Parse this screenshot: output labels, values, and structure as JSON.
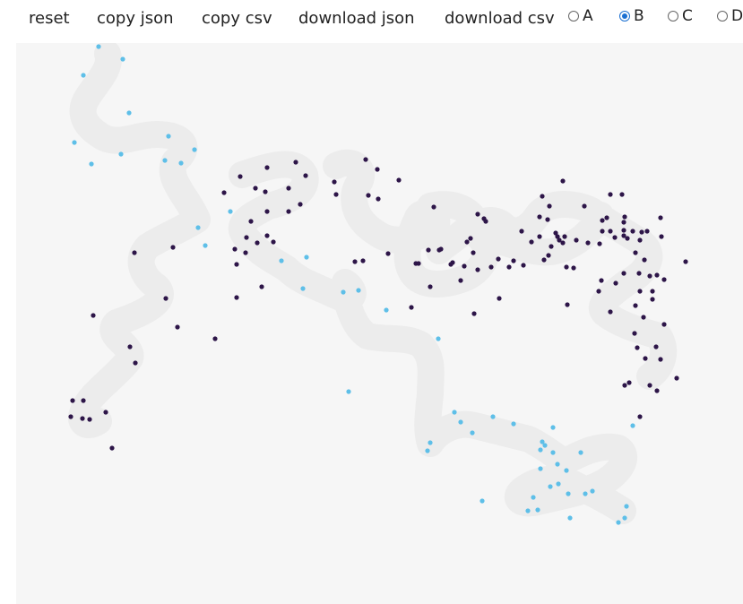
{
  "toolbar": {
    "reset": "reset",
    "copy_json": "copy json",
    "copy_csv": "copy csv",
    "download_json": "download json",
    "download_csv": "download csv"
  },
  "radios": [
    {
      "label": "A",
      "checked": false
    },
    {
      "label": "B",
      "checked": true
    },
    {
      "label": "C",
      "checked": false
    },
    {
      "label": "D",
      "checked": false
    }
  ],
  "colors": {
    "path": "#ececec",
    "series_dark": "#2d1548",
    "series_light": "#5ebfe8",
    "background": "#f6f6f6"
  }
}
